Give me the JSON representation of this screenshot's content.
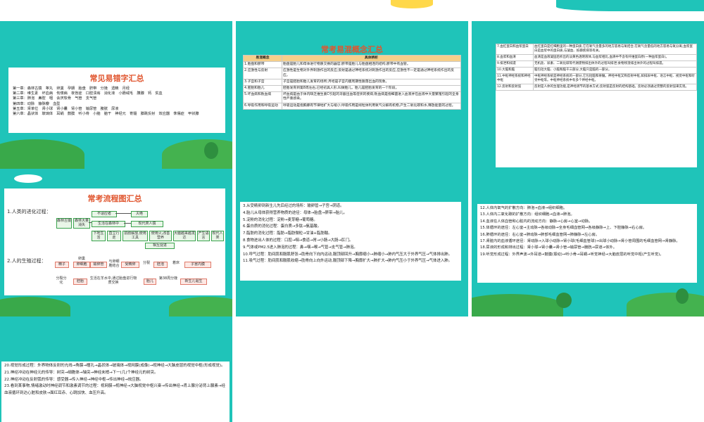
{
  "slide1": {
    "title": "常见易错字汇总",
    "lines": [
      "第一章：森林古猿　睾丸　卵巢　孕期　胎盘　脐带　分娩　遗精　月经",
      "第二章：维生素　坏血病　佝偻病　夜盲症　口腔溃疡　消化液　小肠绒毛　胰腺　钙　贫血",
      "第三章：肺泡　鼻腔　咽　会厌软骨　气管　支气管",
      "第四章：动脉　静脉瓣　血型",
      "第五章：肾单位　肾小球　肾小囊　肾小管　输尿管　膀胱　尿液",
      "第六章：晶状体　玻璃体　耳蜗　鼓膜　听小骨　小脑　脑干　神经元　脊髓　膝跳反射　效应器　侏儒症　甲状腺"
    ]
  },
  "slide2": {
    "title": "常考易混概念汇总",
    "headers": [
      "易混概念",
      "具体辨析"
    ],
    "rows": [
      [
        "1.胎盘和脐带",
        "胎盘是胎儿和母体进行物质交换的器官;脐带是胎儿与胎盘相连的结构,脐带中有血管。"
      ],
      [
        "2.应激性与反射",
        "应激性是生物对外界刺激作出的反应;反射是通过神经系统对刺激作出的反应,应激性不一定是通过神经系统作出的反应。"
      ],
      [
        "3.子宫和子宫",
        "子宫是胚胎和胎儿发育的场所;月经是子宫内膜周期性脱落出血的现象。"
      ],
      [
        "4.胚胎和胎儿",
        "胚胎发育到第8周左右,已经初具人形,叫做胎儿。胎儿是胚胎发育的一个阶段。"
      ],
      [
        "5.坏血病和败血病",
        "坏血病是由于体内缺乏维生素C引起的牙龈出血等症状的疾病;败血病是指细菌进入血液并在血液中大量繁殖引起的全身性严重感染。"
      ],
      [
        "6.呼吸作用和呼吸运动",
        "呼吸运动是指胸廓有节律地扩大与缩小;呼吸作用是线粒体利用氧气分解有机物,产生二氧化碳和水,释放能量的过程。"
      ]
    ]
  },
  "slide3": {
    "rows": [
      [
        "7.血红蛋白和血浆蛋白",
        "血红蛋白是红细胞里的一种蛋白质,它在氧气含量多的地方容易与氧结合,在氧气含量低的地方容易与氧分离;血浆蛋白是血浆中的蛋白质,与凝血、抵御疾病等有关。"
      ],
      [
        "8.血浆和血清",
        "血清是血液凝固后析出的淡黄色透明液体,与血浆相比,血清中不含有纤维蛋白原(一种血浆蛋白)。"
      ],
      [
        "9.排泄和排遗",
        "无机盐、尿素、二氧化碳等代谢废物排出体外的过程叫排泄;食物残渣排出体外的过程叫排遗。"
      ],
      [
        "10.大脑和脑",
        "脑包括大脑、小脑和脑干三部分,大脑只是脑的一部分。"
      ],
      [
        "11.中枢神经系统和神经中枢",
        "中枢神经系统是神经系统的一部分,它包括脑和脊髓。神经中枢又称反射中枢,如排尿中枢、语言中枢、视觉中枢和听觉中枢等。中枢神经系统中有多个神经中枢。"
      ],
      [
        "12.反射和反射弧",
        "反射是人体的生理功能,是神经调节的基本方式;反射弧是反射的结构基础。反射必须通过完整的反射弧来实现。"
      ]
    ]
  },
  "slide4": {
    "title": "常考流程图汇总",
    "section1": "1.人类的进化过程：",
    "section2": "2.人的生殖过程：",
    "evo_boxes": [
      "森林古猿",
      "森林大量消失",
      "不适应者",
      "灭绝",
      "生活在森林中",
      "现代类人猿",
      "下地生活",
      "直立行走",
      "前肢解放,使用工具",
      "使用火,改善营养",
      "大脑越来越发达",
      "产生语言",
      "现代人类",
      "相互促进"
    ],
    "rep_boxes": [
      "精子",
      "卵巢",
      "卵细胞",
      "输卵管",
      "受精卵",
      "分裂",
      "胚泡",
      "着床",
      "子宫内膜",
      "分裂分化",
      "胚胎",
      "生活在羊水中,通过胎盘进行物质交换",
      "胎儿",
      "第38周分娩",
      "新生儿诞生",
      "睾丸",
      "与卵细胞结合"
    ]
  },
  "slide5": {
    "lines": [
      "3.从受精卵到新生儿先后经过的场所：输卵管→子宫→阴道。",
      "4.胎儿从母体获得营养物质的途径：母体→胎盘→脐带→胎儿。",
      "5.淀粉的消化过程：淀粉→麦芽糖→葡萄糖。",
      "6.蛋白质的消化过程：蛋白质→多肽→氨基酸。",
      "7.脂肪的消化过程：脂肪→脂肪微粒→甘油+脂肪酸。",
      "8.食物进出人体的过程：口腔→咽→食道→胃→小肠→大肠→肛门。",
      "9.气体或PM2.5进入肺泡的过程：鼻→咽→喉→气管→支气管→肺泡。",
      "10.呼气过程：肋间肌和膈肌舒张→肋骨向下向内运动,膈顶部回升→胸廓缩小→肺缩小→肺内气压大于外界气压→气体排出肺。",
      "11.吸气过程：肋间肌和膈肌收缩→肋骨向上向外运动,膈顶部下降→胸廓扩大→肺扩大→肺内气压小于外界气压→气体进入肺。"
    ]
  },
  "slide6": {
    "lines": [
      "12.人体内氧气的扩散方向：肺泡→血液→组织细胞。",
      "13.人体内二氧化碳的扩散方向：组织细胞→血液→肺泡。",
      "14.血液在人体血管和心脏内的流动方向：静脉→心房→心室→动脉。",
      "15.体循环的途径：左心室→主动脉→各级动脉→全身毛细血管网→各级静脉→上、下腔静脉→右心房。",
      "16.肺循环的途径：右心室→肺动脉→肺部毛细血管网→肺静脉→左心房。",
      "17.肾脏内的血液循环途径：肾动脉→入球小动脉→肾小球(毛细血管球)→出球小动脉→肾小管周围的毛细血管网→肾静脉。",
      "18.尿液的形成和排出过程：肾小球→肾小囊→肾小管→输尿管→膀胱→尿道→体外。",
      "19.听觉形成过程：外界声波→外耳道→鼓膜(振动)→听小骨→耳蜗→听觉神经→大脑皮层的听觉中枢(产生听觉)。"
    ]
  },
  "slide7": {
    "lines": [
      "20.视觉形成过程：外界物体反射的光线→角膜→瞳孔→晶状体→玻璃体→视网膜(成像)→视神经→大脑皮层的视觉中枢(形成视觉)。",
      "21.神经冲动在神经元的传导：树突→细胞体→轴突→神经末梢→下一(几)个神经元的树突。",
      "22.神经冲动在反射弧的传导：感受器→传入神经→神经中枢→传出神经→效应器。",
      "23.看到某事物,情绪激动时神经调节和激素调节的过程：视网膜→视神经→大脑视觉中枢兴奋→传出神经→肾上腺分泌肾上腺素→经血液循环到达心脏和皮肤→面红耳赤、心跳加快、血压升高。"
    ]
  },
  "colors": {
    "teal": "#1fc4b9",
    "title_red": "#e0552e",
    "table_header": "#f6cf8a"
  }
}
